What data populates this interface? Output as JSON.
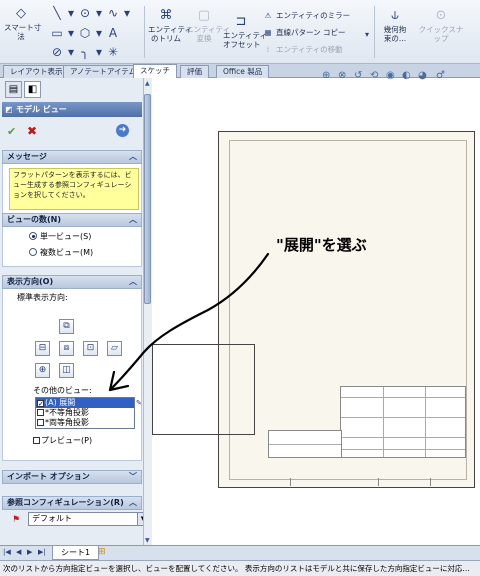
{
  "ribbon": {
    "smart_dimension": "スマート寸\n法",
    "trim_entities": "エンティティ\nのトリム",
    "convert_entities": "エンティティ\n変換",
    "offset_entities": "エンティティ\nオフセット",
    "mirror_entities": "エンティティのミラー",
    "linear_pattern": "直線パターン コピー",
    "move_entities": "エンティティの移動",
    "display_relations": "幾何拘\n束の...",
    "quick_snaps": "クイックスナップ"
  },
  "command_tabs": [
    {
      "label": "レイアウト表示"
    },
    {
      "label": "アノテートアイテム"
    },
    {
      "label": "スケッチ",
      "active": true
    },
    {
      "label": "評価"
    },
    {
      "label": "Office 製品"
    }
  ],
  "panel": {
    "title": "モデル ビュー",
    "message_header": "メッセージ",
    "message_text": "フラットパターンを表示するには、ビュー生成する参照コンフィギュレーションを択してください。",
    "num_views_header": "ビューの数(N)",
    "single_view": "単一ビュー(S)",
    "multiple_views": "複数ビュー(M)",
    "orientation_header": "表示方向(O)",
    "standard_views_label": "標準表示方向:",
    "other_views_label": "その他のビュー:",
    "other_views": [
      {
        "label": "(A) 展開",
        "checked": true,
        "selected": true
      },
      {
        "label": "*不等角投影",
        "checked": false,
        "selected": false
      },
      {
        "label": "*両等角投影",
        "checked": false,
        "selected": false
      }
    ],
    "preview": "プレビュー(P)",
    "import_options_header": "インポート オプション",
    "ref_config_header": "参照コンフィギュレーション(R)",
    "ref_config_value": "デフォルト"
  },
  "annotation": "\"展開\"を選ぶ",
  "sheet_tab": "シート1",
  "status_text": "次のリストから方向指定ビューを選択し、ビューを配置してください。 表示方向のリストはモデルと共に保存した方向指定ビューに対応..."
}
